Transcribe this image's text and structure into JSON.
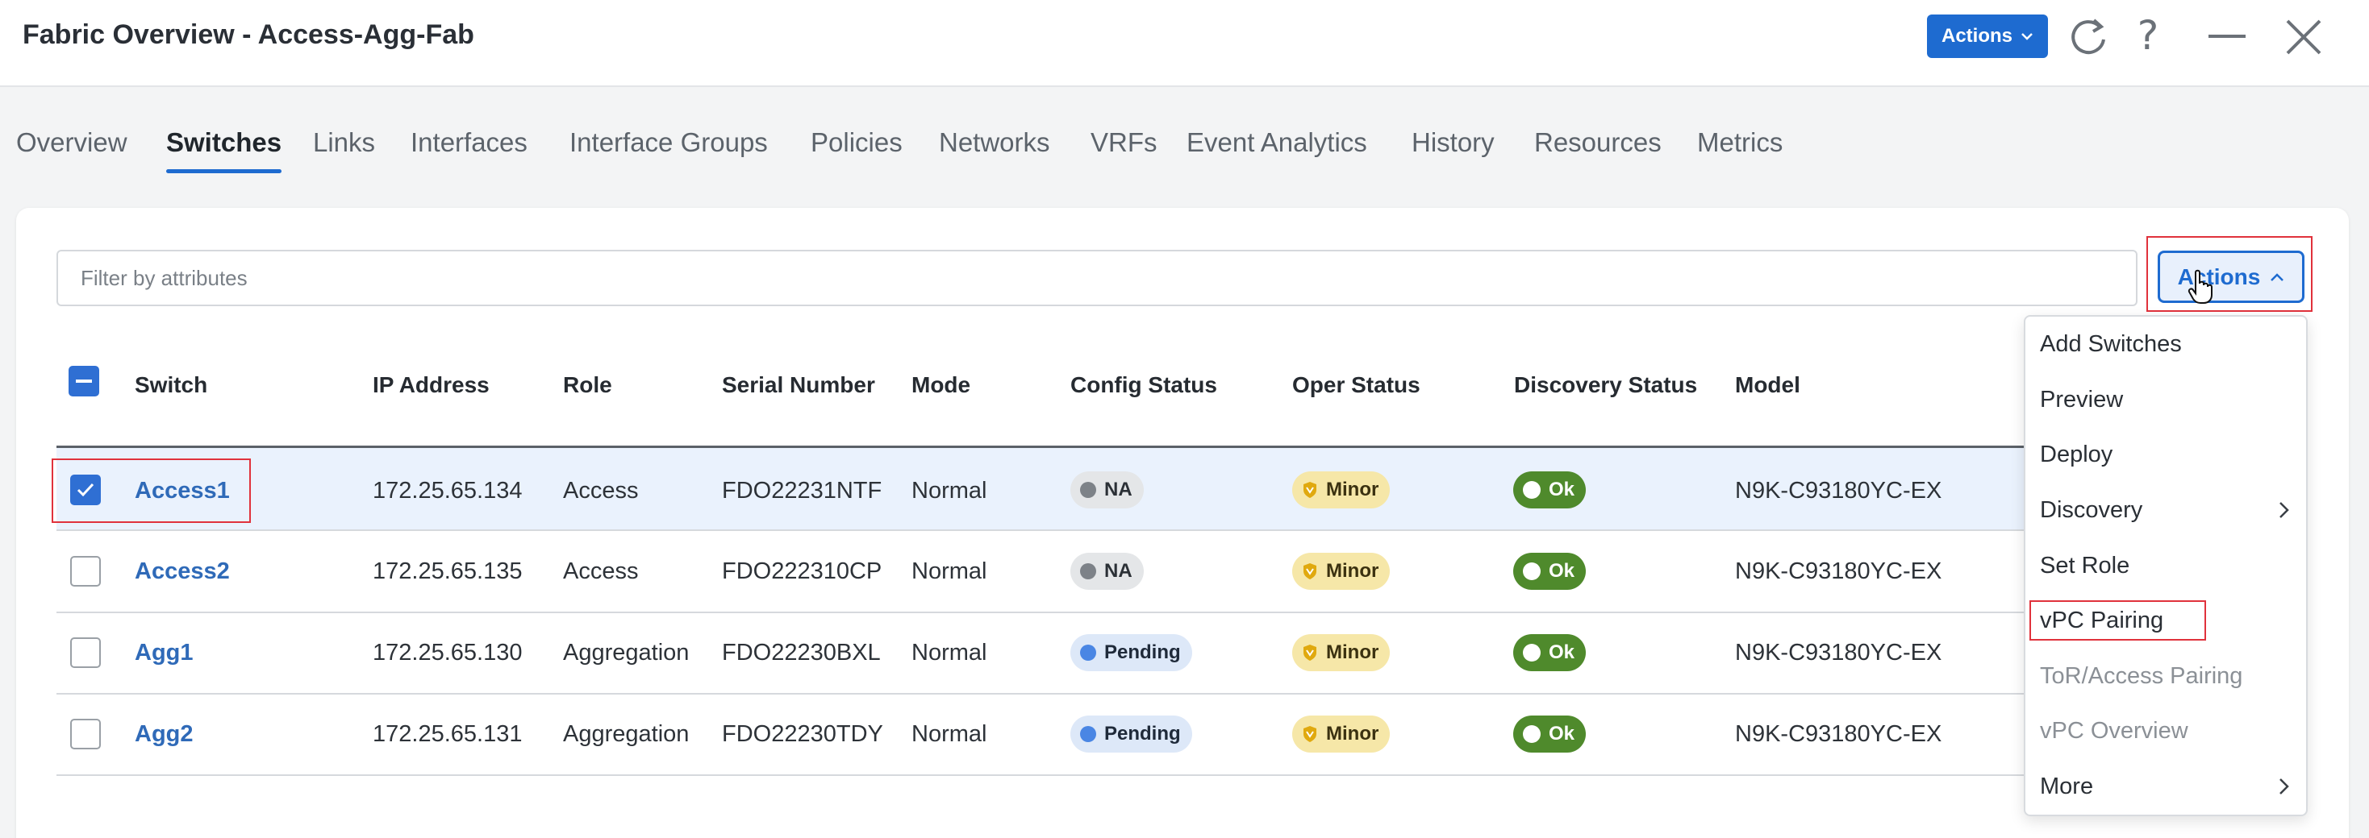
{
  "window": {
    "title": "Fabric Overview - Access-Agg-Fab",
    "actions_label": "Actions"
  },
  "tabs": [
    {
      "label": "Overview"
    },
    {
      "label": "Switches",
      "active": true
    },
    {
      "label": "Links"
    },
    {
      "label": "Interfaces"
    },
    {
      "label": "Interface Groups"
    },
    {
      "label": "Policies"
    },
    {
      "label": "Networks"
    },
    {
      "label": "VRFs"
    },
    {
      "label": "Event Analytics"
    },
    {
      "label": "History"
    },
    {
      "label": "Resources"
    },
    {
      "label": "Metrics"
    }
  ],
  "toolbar": {
    "filter_placeholder": "Filter by attributes",
    "actions_label": "Actions"
  },
  "table": {
    "columns": [
      "Switch",
      "IP Address",
      "Role",
      "Serial Number",
      "Mode",
      "Config Status",
      "Oper Status",
      "Discovery Status",
      "Model"
    ],
    "rows": [
      {
        "switch": "Access1",
        "ip": "172.25.65.134",
        "role": "Access",
        "serial": "FDO22231NTF",
        "mode": "Normal",
        "config": "NA",
        "oper": "Minor",
        "discovery": "Ok",
        "model": "N9K-C93180YC-EX",
        "selected": true
      },
      {
        "switch": "Access2",
        "ip": "172.25.65.135",
        "role": "Access",
        "serial": "FDO222310CP",
        "mode": "Normal",
        "config": "NA",
        "oper": "Minor",
        "discovery": "Ok",
        "model": "N9K-C93180YC-EX",
        "selected": false
      },
      {
        "switch": "Agg1",
        "ip": "172.25.65.130",
        "role": "Aggregation",
        "serial": "FDO22230BXL",
        "mode": "Normal",
        "config": "Pending",
        "oper": "Minor",
        "discovery": "Ok",
        "model": "N9K-C93180YC-EX",
        "selected": false
      },
      {
        "switch": "Agg2",
        "ip": "172.25.65.131",
        "role": "Aggregation",
        "serial": "FDO22230TDY",
        "mode": "Normal",
        "config": "Pending",
        "oper": "Minor",
        "discovery": "Ok",
        "model": "N9K-C93180YC-EX",
        "selected": false
      }
    ]
  },
  "actions_menu": {
    "items": [
      {
        "label": "Add Switches",
        "enabled": true,
        "submenu": false
      },
      {
        "label": "Preview",
        "enabled": true,
        "submenu": false
      },
      {
        "label": "Deploy",
        "enabled": true,
        "submenu": false
      },
      {
        "label": "Discovery",
        "enabled": true,
        "submenu": true
      },
      {
        "label": "Set Role",
        "enabled": true,
        "submenu": false
      },
      {
        "label": "vPC Pairing",
        "enabled": true,
        "submenu": false,
        "highlighted": true
      },
      {
        "label": "ToR/Access Pairing",
        "enabled": false,
        "submenu": false
      },
      {
        "label": "vPC Overview",
        "enabled": false,
        "submenu": false
      },
      {
        "label": "More",
        "enabled": true,
        "submenu": true
      }
    ]
  },
  "colors": {
    "accent": "#1e6bd0",
    "highlight": "#e0323c",
    "ok": "#4f8a2c",
    "minor": "#f6e7a8",
    "pending": "#dde8f8",
    "selected_row": "#eaf2fd"
  }
}
